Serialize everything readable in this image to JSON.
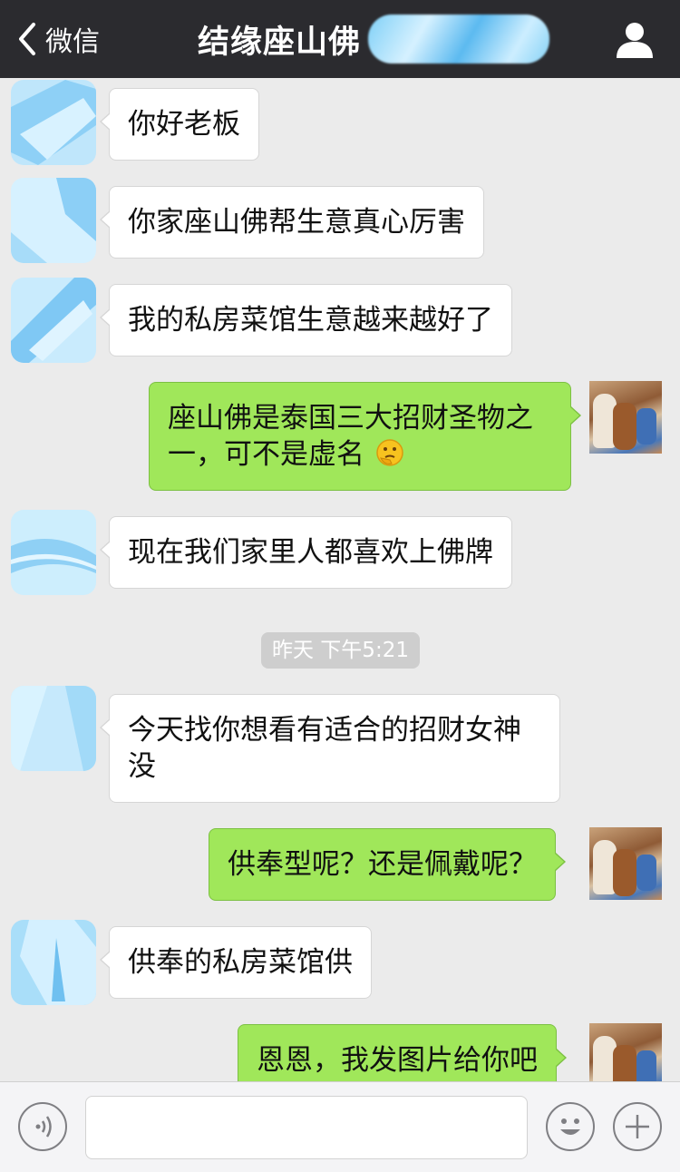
{
  "header": {
    "back_label": "微信",
    "title": "结缘座山佛"
  },
  "messages": [
    {
      "side": "left",
      "text": "你好老板"
    },
    {
      "side": "left",
      "text": "你家座山佛帮生意真心厉害"
    },
    {
      "side": "left",
      "text": "我的私房菜馆生意越来越好了"
    },
    {
      "side": "right",
      "line1": "座山佛是泰国三大招财圣物之",
      "line2": "一，可不是虚名",
      "emoji": "thinking-face-emoji"
    },
    {
      "side": "left",
      "text": "现在我们家里人都喜欢上佛牌"
    },
    {
      "side": "left",
      "line1": "今天找你想看有适合的招财女神",
      "line2": "没"
    },
    {
      "side": "right",
      "text": "供奉型呢？还是佩戴呢？"
    },
    {
      "side": "left",
      "text": "供奉的私房菜馆供"
    },
    {
      "side": "right",
      "text": "恩恩，我发图片给你吧"
    }
  ],
  "timestamp": "昨天 下午5:21",
  "input_bar": {
    "voice_icon": "voice-icon",
    "emoji_icon": "smiley-icon",
    "more_icon": "plus-icon",
    "text_value": ""
  },
  "colors": {
    "header_bg": "#2b2b2f",
    "chat_bg": "#ebebeb",
    "sent_bubble": "#a0e75a",
    "received_bubble": "#ffffff"
  }
}
